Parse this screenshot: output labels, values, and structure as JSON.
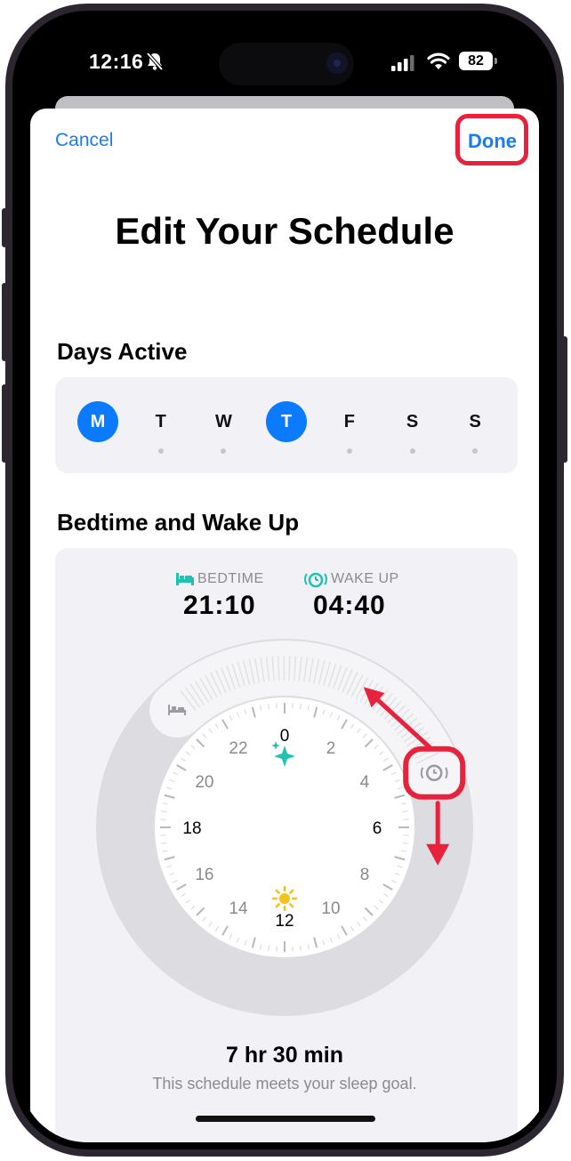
{
  "status_bar": {
    "time": "12:16",
    "battery": "82"
  },
  "nav": {
    "cancel_label": "Cancel",
    "done_label": "Done"
  },
  "title": "Edit Your Schedule",
  "days_active": {
    "heading": "Days Active",
    "days": [
      {
        "letter": "M",
        "selected": true
      },
      {
        "letter": "T",
        "selected": false
      },
      {
        "letter": "W",
        "selected": false
      },
      {
        "letter": "T",
        "selected": true
      },
      {
        "letter": "F",
        "selected": false
      },
      {
        "letter": "S",
        "selected": false
      },
      {
        "letter": "S",
        "selected": false
      }
    ]
  },
  "schedule": {
    "heading": "Bedtime and Wake Up",
    "bedtime_label": "BEDTIME",
    "bedtime_value": "21:10",
    "wakeup_label": "WAKE UP",
    "wakeup_value": "04:40",
    "clock_numbers": [
      "0",
      "2",
      "4",
      "6",
      "8",
      "10",
      "12",
      "14",
      "16",
      "18",
      "20",
      "22"
    ],
    "duration": "7 hr 30 min",
    "goal_text": "This schedule meets your sleep goal."
  },
  "colors": {
    "accent": "#0a7aff",
    "bedtime_icon": "#1fc2b0",
    "wakeup_icon": "#1fc2b0",
    "annotation": "#e8213c",
    "sun": "#f5c21b",
    "sparkle": "#1fc2b0"
  },
  "icons": [
    "bell-slash-icon",
    "signal-icon",
    "wifi-icon",
    "battery-icon",
    "bed-icon",
    "alarm-icon",
    "sparkle-icon",
    "sun-icon"
  ]
}
